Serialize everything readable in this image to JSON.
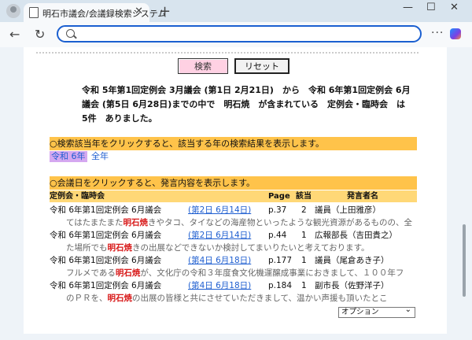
{
  "browser": {
    "tab_title": "明石市議会/会議録検索システム",
    "tab_close": "✕",
    "new_tab": "+",
    "address_placeholder": "",
    "more": "···",
    "back": "←",
    "refresh": "↻",
    "win_min": "—",
    "win_max": "☐",
    "win_close": "✕"
  },
  "buttons": {
    "search": "検索",
    "reset": "リセット"
  },
  "summary": "令和 5年第1回定例会 3月議会 (第1日 2月21日)　から　令和 6年第1回定例会 6月議会 (第5日 6月28日)までの中で　明石焼　が含まれている　定例会・臨時会　は　5件　ありました。",
  "year_section": {
    "instruction": "○検索該当年をクリックすると、該当する年の検索結果を表示します。",
    "years": [
      "令和 6年",
      "全年"
    ]
  },
  "meeting_section": {
    "instruction": "○会議日をクリックすると、発言内容を表示します。",
    "columns": {
      "meeting": "定例会・臨時会",
      "page": "Page",
      "hit": "該当",
      "speaker": "発言者名"
    },
    "rows": [
      {
        "meeting": "令和 6年第1回定例会 6月議会",
        "date": "(第2日 6月14日)",
        "page": "p.37",
        "hit": "2",
        "speaker": "議員（上田雅彦）",
        "snippet_pre": "てはたまたまた",
        "keyword": "明石焼",
        "snippet_post": "きやタコ、タイなどの海産物といったような観光資源があるものの、全"
      },
      {
        "meeting": "令和 6年第1回定例会 6月議会",
        "date": "(第2日 6月14日)",
        "page": "p.44",
        "hit": "1",
        "speaker": "広報部長（吉田貴之）",
        "snippet_pre": "た場所でも",
        "keyword": "明石焼",
        "snippet_post": "きの出展などできないか検討してまいりたいと考えております。"
      },
      {
        "meeting": "令和 6年第1回定例会 6月議会",
        "date": "(第4日 6月18日)",
        "page": "p.177",
        "hit": "1",
        "speaker": "議員（尾倉あき子）",
        "snippet_pre": "フルメである",
        "keyword": "明石焼",
        "snippet_post": "が、文化庁の令和３年度食文化機運醸成事業におきまして、１００年フ"
      },
      {
        "meeting": "令和 6年第1回定例会 6月議会",
        "date": "(第4日 6月18日)",
        "page": "p.184",
        "hit": "1",
        "speaker": "副市長（佐野洋子）",
        "snippet_pre": "のＰＲを、",
        "keyword": "明石焼",
        "snippet_post": "の出展の皆様と共にさせていただきまして、温かい声援も頂いたとこ"
      }
    ]
  },
  "option_select": "オプション"
}
